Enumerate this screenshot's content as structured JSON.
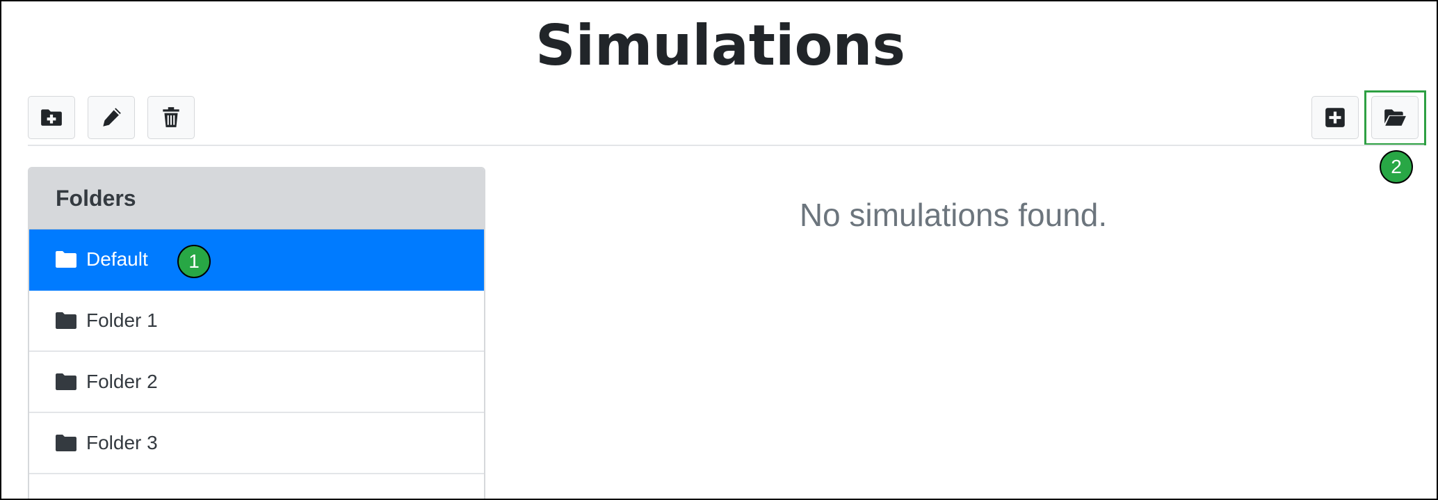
{
  "page": {
    "title": "Simulations"
  },
  "toolbar": {
    "left_buttons": [
      {
        "name": "new-folder-button",
        "icon": "folder-plus-icon"
      },
      {
        "name": "rename-folder-button",
        "icon": "pencil-icon"
      },
      {
        "name": "delete-folder-button",
        "icon": "trash-icon"
      }
    ],
    "right_buttons": [
      {
        "name": "new-simulation-button",
        "icon": "plus-square-icon"
      },
      {
        "name": "open-simulation-button",
        "icon": "folder-open-icon"
      }
    ]
  },
  "folders": {
    "header": "Folders",
    "items": [
      {
        "label": "Default",
        "active": true
      },
      {
        "label": "Folder 1",
        "active": false
      },
      {
        "label": "Folder 2",
        "active": false
      },
      {
        "label": "Folder 3",
        "active": false
      }
    ]
  },
  "main": {
    "empty_message": "No simulations found."
  },
  "annotations": {
    "badge_1": "1",
    "badge_2": "2"
  },
  "colors": {
    "accent": "#007bff",
    "callout": "#28a745"
  }
}
